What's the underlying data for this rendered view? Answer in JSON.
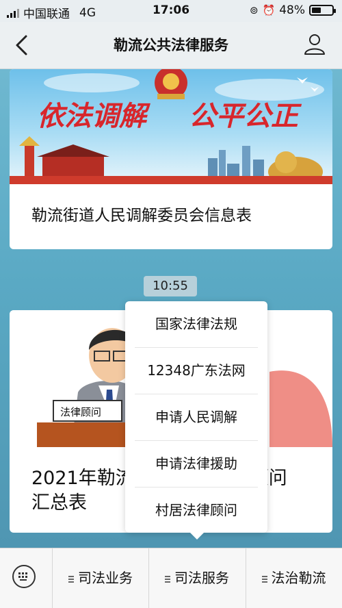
{
  "status_bar": {
    "carrier": "中国联通",
    "network": "4G",
    "time": "17:06",
    "battery_percent": "48%",
    "battery_level": 0.48
  },
  "navbar": {
    "title": "勒流公共法律服务"
  },
  "messages": [
    {
      "banner_text_left": "依法调解",
      "banner_text_right": "公平公正",
      "caption": "勒流街道人民调解委员会信息表"
    },
    {
      "sign_text": "法律顾问",
      "caption": "2021年勒流...顾问汇总表",
      "caption_visible_left": "2021年勒流",
      "caption_visible_right": "顾问",
      "caption_line2": "汇总表"
    }
  ],
  "timestamp": "10:55",
  "popup_menu": {
    "items": [
      "国家法律法规",
      "12348广东法网",
      "申请人民调解",
      "申请法律援助",
      "村居法律顾问"
    ]
  },
  "bottom_menu": {
    "items": [
      "司法业务",
      "司法服务",
      "法治勒流"
    ]
  },
  "colors": {
    "accent_red": "#d8262c",
    "background_blue": "#5aa7c2"
  }
}
